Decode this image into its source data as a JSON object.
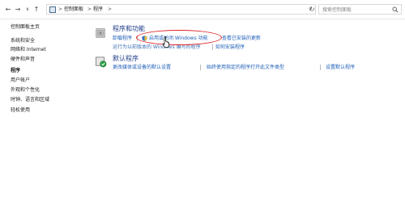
{
  "address_bar": {
    "back": "←",
    "forward": "→",
    "recent": "∨",
    "up": "↑",
    "breadcrumb": [
      "控制面板",
      "程序"
    ],
    "separator": ">",
    "dropdown": "∨",
    "refresh": "↻",
    "search_placeholder": "搜索控制面板"
  },
  "sidebar": {
    "home": "控制面板主页",
    "items": [
      "系统和安全",
      "网络和 Internet",
      "硬件和声音",
      "程序",
      "用户帐户",
      "外观和个性化",
      "时钟、语言和区域",
      "轻松使用"
    ],
    "current_index": 3
  },
  "categories": [
    {
      "title": "程序和功能",
      "tasks_row1": [
        "卸载程序",
        "启用或关闭 Windows 功能",
        "查看已安装的更新"
      ],
      "tasks_row2": [
        "运行为以前版本的 Windows 编写的程序",
        "如何安装程序"
      ]
    },
    {
      "title": "默认程序",
      "tasks_row1": [
        "更改媒体或设备的默认设置",
        "始终使用指定的程序打开此文件类型",
        "设置默认程序"
      ]
    }
  ],
  "colors": {
    "link": "#1f5fb8",
    "title": "#1e3d8a",
    "highlight": "#e0262b"
  }
}
